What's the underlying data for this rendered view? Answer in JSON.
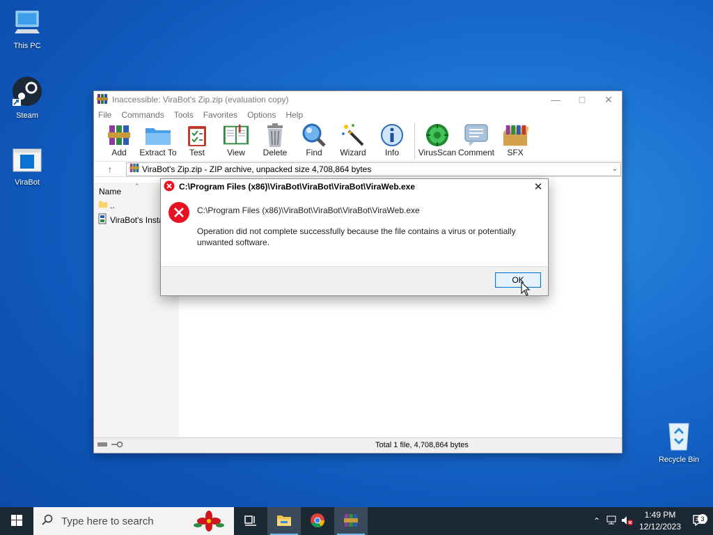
{
  "desktop": {
    "icons": [
      {
        "label": "This PC",
        "icon": "computer-icon"
      },
      {
        "label": "Steam",
        "icon": "steam-icon"
      },
      {
        "label": "ViraBot",
        "icon": "app-window-icon"
      },
      {
        "label": "Recycle Bin",
        "icon": "recycle-bin-icon"
      }
    ]
  },
  "winrar": {
    "title": "Inaccessible: ViraBot's Zip.zip (evaluation copy)",
    "menu": [
      "File",
      "Commands",
      "Tools",
      "Favorites",
      "Options",
      "Help"
    ],
    "toolbar": [
      {
        "label": "Add",
        "icon": "add-archive-icon"
      },
      {
        "label": "Extract To",
        "icon": "extract-folder-icon"
      },
      {
        "label": "Test",
        "icon": "test-clipboard-icon"
      },
      {
        "label": "View",
        "icon": "view-book-icon"
      },
      {
        "label": "Delete",
        "icon": "trash-icon"
      },
      {
        "label": "Find",
        "icon": "magnifier-icon"
      },
      {
        "label": "Wizard",
        "icon": "wand-icon"
      },
      {
        "label": "Info",
        "icon": "info-icon"
      },
      {
        "label": "VirusScan",
        "icon": "virus-scan-icon"
      },
      {
        "label": "Comment",
        "icon": "comment-icon"
      },
      {
        "label": "SFX",
        "icon": "sfx-box-icon"
      }
    ],
    "address": "ViraBot's Zip.zip - ZIP archive, unpacked size 4,708,864 bytes",
    "list": {
      "column_name": "Name",
      "up_row": "..",
      "file_row": "ViraBot's Install"
    },
    "status": "Total 1 file, 4,708,864 bytes"
  },
  "dialog": {
    "title": "C:\\Program Files (x86)\\ViraBot\\ViraBot\\ViraBot\\ViraWeb.exe",
    "path": "C:\\Program Files (x86)\\ViraBot\\ViraBot\\ViraBot\\ViraWeb.exe",
    "message": "Operation did not complete successfully because the file contains a virus or potentially unwanted software.",
    "ok_label": "OK"
  },
  "taskbar": {
    "search_placeholder": "Type here to search",
    "time": "1:49 PM",
    "date": "12/12/2023",
    "notification_count": "3"
  },
  "colors": {
    "accent": "#0078d7",
    "error_red": "#e81123",
    "taskbar": "#1b2733"
  }
}
